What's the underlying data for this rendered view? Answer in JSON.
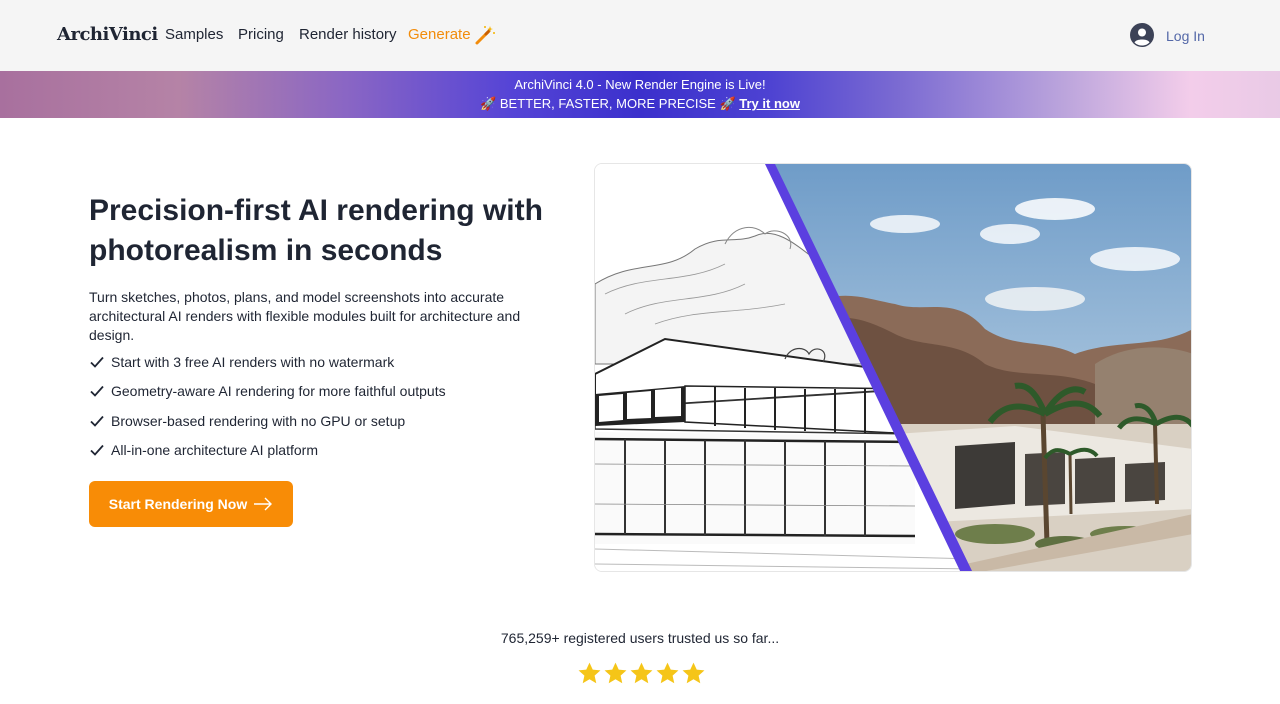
{
  "nav": {
    "logo": {
      "bold": "ArchiVinci",
      "light": ""
    },
    "links": [
      "Samples",
      "Pricing",
      "Render history",
      "Generate"
    ],
    "generate_icon": "magic-wand-icon",
    "login_label": "Log In",
    "login_icon": "user-avatar-icon"
  },
  "banner": {
    "line1": "ArchiVinci 4.0 - New Render Engine is Live!",
    "line2": "🚀 BETTER, FASTER, MORE PRECISE 🚀",
    "link": "Try it now"
  },
  "hero": {
    "title": "Precision-first AI rendering with photorealism in seconds",
    "subtitle": "Turn sketches, photos, plans, and model screenshots into accurate architectural AI renders with flexible modules built for architecture and design.",
    "features": [
      "Start with 3 free AI renders with no watermark",
      "Geometry-aware AI rendering for more faithful outputs",
      "Browser-based rendering with no GPU or setup",
      "All-in-one architecture AI platform"
    ],
    "cta_label": "Start Rendering Now",
    "cta_icon": "arrow-right-icon"
  },
  "social_proof": {
    "users_text": "765,259+ registered users trusted us so far...",
    "rating_stars": 5
  },
  "colors": {
    "accent": "#f88c06",
    "generate_link": "#f28c0b",
    "star": "#f5c518",
    "divider": "#5b3fe0"
  }
}
